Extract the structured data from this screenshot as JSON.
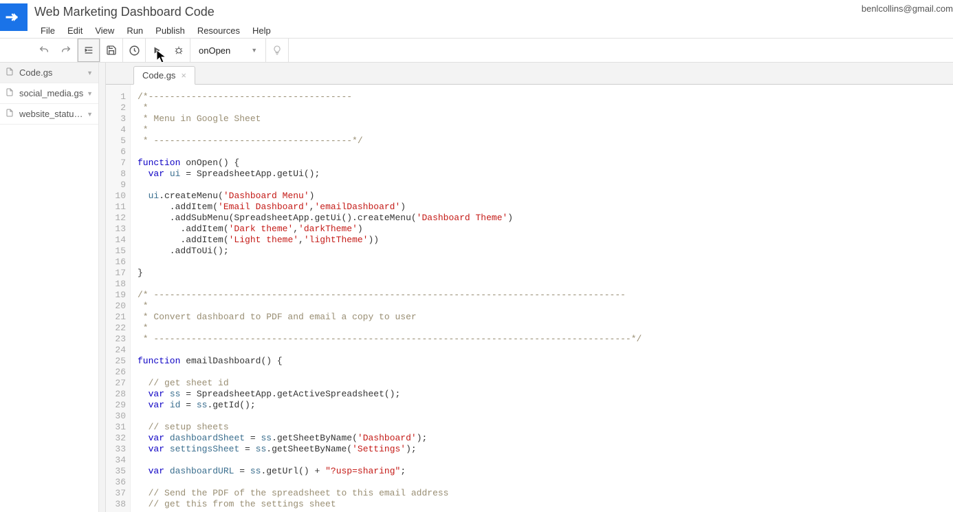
{
  "project": {
    "title": "Web Marketing Dashboard Code"
  },
  "user": {
    "email": "benlcollins@gmail.com"
  },
  "menubar": [
    "File",
    "Edit",
    "View",
    "Run",
    "Publish",
    "Resources",
    "Help"
  ],
  "toolbar": {
    "function_selected": "onOpen"
  },
  "sidebar": {
    "files": [
      {
        "name": "Code.gs",
        "active": true
      },
      {
        "name": "social_media.gs",
        "active": false
      },
      {
        "name": "website_statu…",
        "active": false
      }
    ]
  },
  "editor": {
    "active_tab": "Code.gs",
    "lines": [
      [
        [
          "comment",
          "/*--------------------------------------"
        ]
      ],
      [
        [
          "comment",
          " *"
        ]
      ],
      [
        [
          "comment",
          " * Menu in Google Sheet"
        ]
      ],
      [
        [
          "comment",
          " *"
        ]
      ],
      [
        [
          "comment",
          " * -------------------------------------*/"
        ]
      ],
      [
        [
          "text",
          ""
        ]
      ],
      [
        [
          "keyword",
          "function"
        ],
        [
          "text",
          " onOpen() {"
        ]
      ],
      [
        [
          "text",
          "  "
        ],
        [
          "keyword",
          "var"
        ],
        [
          "text",
          " "
        ],
        [
          "var",
          "ui"
        ],
        [
          "text",
          " = SpreadsheetApp.getUi();"
        ]
      ],
      [
        [
          "text",
          ""
        ]
      ],
      [
        [
          "text",
          "  "
        ],
        [
          "var",
          "ui"
        ],
        [
          "text",
          ".createMenu("
        ],
        [
          "string",
          "'Dashboard Menu'"
        ],
        [
          "text",
          ")"
        ]
      ],
      [
        [
          "text",
          "      .addItem("
        ],
        [
          "string",
          "'Email Dashboard'"
        ],
        [
          "text",
          ","
        ],
        [
          "string",
          "'emailDashboard'"
        ],
        [
          "text",
          ")"
        ]
      ],
      [
        [
          "text",
          "      .addSubMenu(SpreadsheetApp.getUi().createMenu("
        ],
        [
          "string",
          "'Dashboard Theme'"
        ],
        [
          "text",
          ")"
        ]
      ],
      [
        [
          "text",
          "        .addItem("
        ],
        [
          "string",
          "'Dark theme'"
        ],
        [
          "text",
          ","
        ],
        [
          "string",
          "'darkTheme'"
        ],
        [
          "text",
          ")"
        ]
      ],
      [
        [
          "text",
          "        .addItem("
        ],
        [
          "string",
          "'Light theme'"
        ],
        [
          "text",
          ","
        ],
        [
          "string",
          "'lightTheme'"
        ],
        [
          "text",
          "))"
        ]
      ],
      [
        [
          "text",
          "      .addToUi();"
        ]
      ],
      [
        [
          "text",
          ""
        ]
      ],
      [
        [
          "text",
          "}"
        ]
      ],
      [
        [
          "text",
          ""
        ]
      ],
      [
        [
          "comment",
          "/* ----------------------------------------------------------------------------------------"
        ]
      ],
      [
        [
          "comment",
          " *"
        ]
      ],
      [
        [
          "comment",
          " * Convert dashboard to PDF and email a copy to user"
        ]
      ],
      [
        [
          "comment",
          " *"
        ]
      ],
      [
        [
          "comment",
          " * -----------------------------------------------------------------------------------------*/"
        ]
      ],
      [
        [
          "text",
          ""
        ]
      ],
      [
        [
          "keyword",
          "function"
        ],
        [
          "text",
          " emailDashboard() {"
        ]
      ],
      [
        [
          "text",
          ""
        ]
      ],
      [
        [
          "text",
          "  "
        ],
        [
          "comment",
          "// get sheet id"
        ]
      ],
      [
        [
          "text",
          "  "
        ],
        [
          "keyword",
          "var"
        ],
        [
          "text",
          " "
        ],
        [
          "var",
          "ss"
        ],
        [
          "text",
          " = SpreadsheetApp.getActiveSpreadsheet();"
        ]
      ],
      [
        [
          "text",
          "  "
        ],
        [
          "keyword",
          "var"
        ],
        [
          "text",
          " "
        ],
        [
          "var",
          "id"
        ],
        [
          "text",
          " = "
        ],
        [
          "var",
          "ss"
        ],
        [
          "text",
          ".getId();"
        ]
      ],
      [
        [
          "text",
          ""
        ]
      ],
      [
        [
          "text",
          "  "
        ],
        [
          "comment",
          "// setup sheets"
        ]
      ],
      [
        [
          "text",
          "  "
        ],
        [
          "keyword",
          "var"
        ],
        [
          "text",
          " "
        ],
        [
          "var",
          "dashboardSheet"
        ],
        [
          "text",
          " = "
        ],
        [
          "var",
          "ss"
        ],
        [
          "text",
          ".getSheetByName("
        ],
        [
          "string",
          "'Dashboard'"
        ],
        [
          "text",
          ");"
        ]
      ],
      [
        [
          "text",
          "  "
        ],
        [
          "keyword",
          "var"
        ],
        [
          "text",
          " "
        ],
        [
          "var",
          "settingsSheet"
        ],
        [
          "text",
          " = "
        ],
        [
          "var",
          "ss"
        ],
        [
          "text",
          ".getSheetByName("
        ],
        [
          "string",
          "'Settings'"
        ],
        [
          "text",
          ");"
        ]
      ],
      [
        [
          "text",
          ""
        ]
      ],
      [
        [
          "text",
          "  "
        ],
        [
          "keyword",
          "var"
        ],
        [
          "text",
          " "
        ],
        [
          "var",
          "dashboardURL"
        ],
        [
          "text",
          " = "
        ],
        [
          "var",
          "ss"
        ],
        [
          "text",
          ".getUrl() + "
        ],
        [
          "string",
          "\"?usp=sharing\""
        ],
        [
          "text",
          ";"
        ]
      ],
      [
        [
          "text",
          ""
        ]
      ],
      [
        [
          "text",
          "  "
        ],
        [
          "comment",
          "// Send the PDF of the spreadsheet to this email address"
        ]
      ],
      [
        [
          "text",
          "  "
        ],
        [
          "comment",
          "// get this from the settings sheet"
        ]
      ]
    ]
  }
}
